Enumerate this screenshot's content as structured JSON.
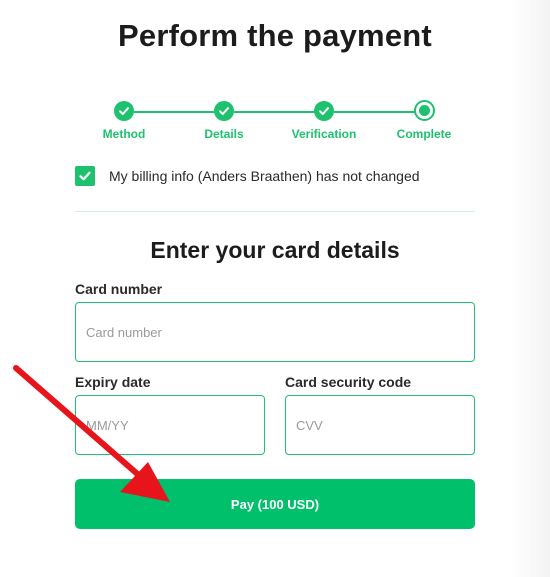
{
  "page": {
    "title": "Perform the payment"
  },
  "stepper": {
    "steps": [
      {
        "label": "Method",
        "state": "done"
      },
      {
        "label": "Details",
        "state": "done"
      },
      {
        "label": "Verification",
        "state": "done"
      },
      {
        "label": "Complete",
        "state": "current"
      }
    ]
  },
  "billing": {
    "label": "My billing info (Anders Braathen) has not changed",
    "checked": true
  },
  "card": {
    "section_title": "Enter your card details",
    "number_label": "Card number",
    "number_placeholder": "Card number",
    "expiry_label": "Expiry date",
    "expiry_placeholder": "MM/YY",
    "cvv_label": "Card security code",
    "cvv_placeholder": "CVV"
  },
  "pay_button": {
    "label": "Pay (100 USD)"
  },
  "colors": {
    "accent": "#1ec26e",
    "button": "#00c06b",
    "arrow": "#e8141c"
  }
}
